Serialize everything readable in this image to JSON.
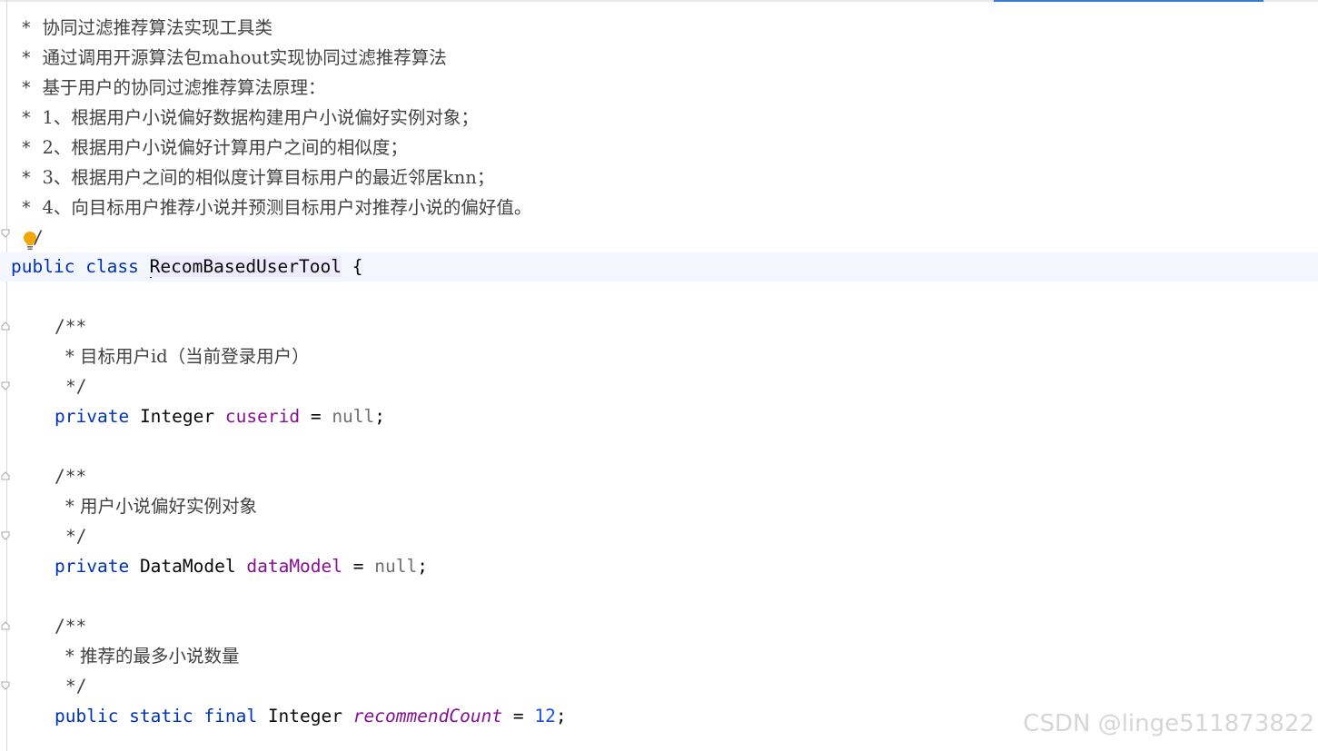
{
  "editor": {
    "language": "java",
    "caret_line": "class_declaration",
    "class_doc": {
      "prefix": "* ",
      "lines": [
        "协同过滤推荐算法实现工具类",
        "通过调用开源算法包mahout实现协同过滤推荐算法",
        "基于用户的协同过滤推荐算法原理：",
        "1、根据用户小说偏好数据构建用户小说偏好实例对象；",
        "2、根据用户小说偏好计算用户之间的相似度；",
        "3、根据用户之间的相似度计算目标用户的最近邻居knn；",
        "4、向目标用户推荐小说并预测目标用户对推荐小说的偏好值。"
      ],
      "close": "/"
    },
    "class_decl": {
      "kw_public": "public",
      "kw_class": "class",
      "name": "RecomBasedUserTool",
      "brace": "{"
    },
    "fields": [
      {
        "doc_open": "/**",
        "doc_text": "* 目标用户id（当前登录用户）",
        "doc_close": "*/",
        "modifiers": "private",
        "type": "Integer",
        "name": "cuserid",
        "assign": "=",
        "value": "null",
        "end": ";"
      },
      {
        "doc_open": "/**",
        "doc_text": "* 用户小说偏好实例对象",
        "doc_close": "*/",
        "modifiers": "private",
        "type": "DataModel",
        "name": "dataModel",
        "assign": "=",
        "value": "null",
        "end": ";"
      },
      {
        "doc_open": "/**",
        "doc_text": "* 推荐的最多小说数量",
        "doc_close": "*/",
        "modifiers": "public static final",
        "type": "Integer",
        "name": "recommendCount",
        "assign": "=",
        "value": "12",
        "end": ";"
      }
    ]
  },
  "watermark": "CSDN @linge511873822",
  "colors": {
    "keyword": "#0033b3",
    "field": "#871094",
    "null_literal": "#707070",
    "number": "#1750eb",
    "comment": "#424242",
    "current_line": "#f4f6fe",
    "identifier_highlight": "#edebfc",
    "tab_indicator": "#3a7bd5",
    "intention_bulb": "#f2a50c"
  },
  "icons": [
    "intention-bulb-icon",
    "fold-marker-icon"
  ]
}
